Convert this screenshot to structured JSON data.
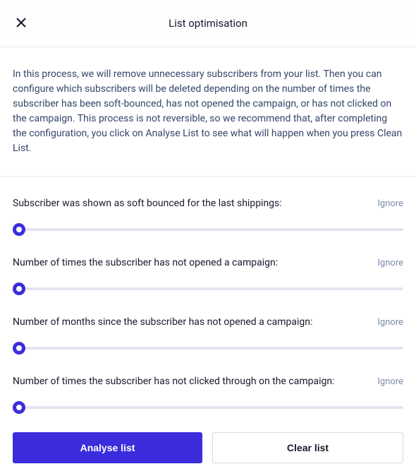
{
  "header": {
    "title": "List optimisation"
  },
  "intro": "In this process, we will remove unnecessary subscribers from your list. Then you can configure which subscribers will be deleted depending on the number of times the subscriber has been soft-bounced, has not opened the campaign, or has not clicked on the campaign. This process is not reversible, so we recommend that, after completing the configuration, you click on Analyse List to see what will happen when you press Clean List.",
  "criteria": {
    "ignore_label": "Ignore",
    "items": [
      {
        "label": "Subscriber was shown as soft bounced for the last shippings:"
      },
      {
        "label": "Number of times the subscriber has not opened a campaign:"
      },
      {
        "label": "Number of months since the subscriber has not opened a campaign:"
      },
      {
        "label": "Number of times the subscriber has not clicked through on the campaign:"
      }
    ]
  },
  "footer": {
    "analyse_label": "Analyse list",
    "clear_label": "Clear list"
  }
}
